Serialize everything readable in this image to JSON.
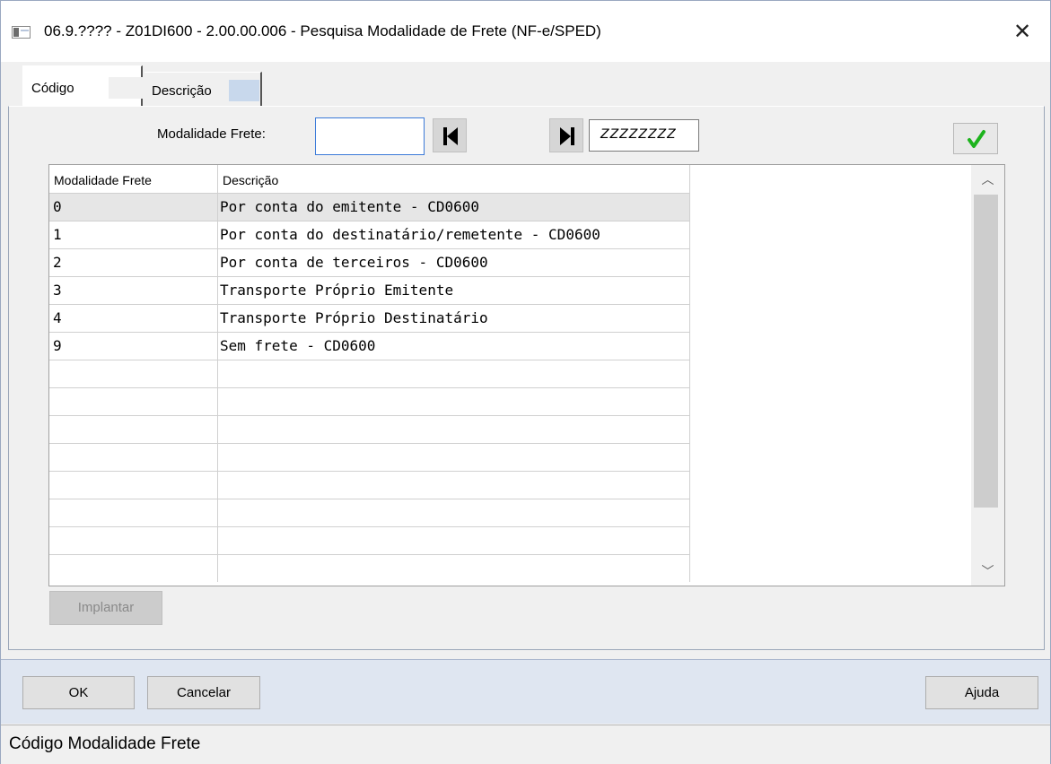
{
  "window": {
    "title": "06.9.???? - Z01DI600 - 2.00.00.006 - Pesquisa Modalidade de Frete (NF-e/SPED)",
    "close_glyph": "✕"
  },
  "tabs": [
    {
      "label": "Código",
      "active": true
    },
    {
      "label": "Descrição",
      "active": false
    }
  ],
  "filter": {
    "label": "Modalidade Frete:",
    "from_value": "",
    "to_value": "ZZZZZZZZ"
  },
  "grid": {
    "columns": [
      "Modalidade Frete",
      "Descrição"
    ],
    "rows": [
      {
        "code": "0",
        "desc": "Por conta do emitente - CD0600"
      },
      {
        "code": "1",
        "desc": "Por conta do destinatário/remetente - CD0600"
      },
      {
        "code": "2",
        "desc": "Por conta de terceiros - CD0600"
      },
      {
        "code": "3",
        "desc": "Transporte Próprio Emitente"
      },
      {
        "code": "4",
        "desc": "Transporte Próprio Destinatário"
      },
      {
        "code": "9",
        "desc": "Sem frete - CD0600"
      }
    ],
    "empty_rows": 8,
    "selected_index": 0
  },
  "buttons": {
    "implantar": "Implantar",
    "ok": "OK",
    "cancelar": "Cancelar",
    "ajuda": "Ajuda"
  },
  "status": {
    "text": "Código Modalidade Frete"
  },
  "colors": {
    "accent": "#3b7ad8",
    "check": "#1db31d",
    "bottom_band": "#dfe6f1"
  }
}
